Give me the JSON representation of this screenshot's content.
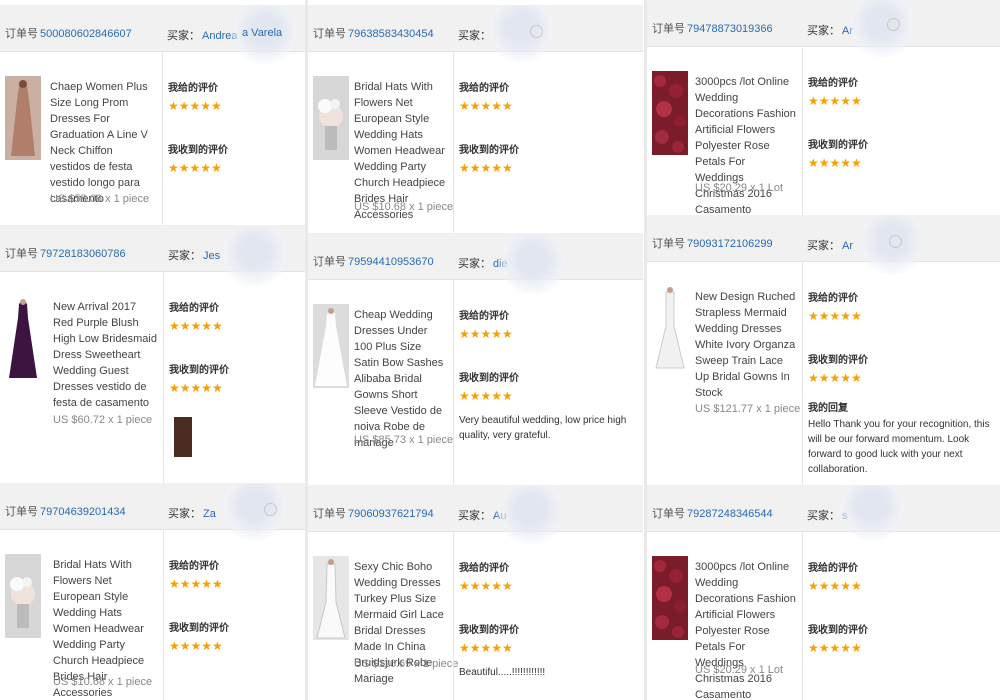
{
  "labels": {
    "order_prefix": "订单号",
    "buyer_prefix": "买家：",
    "my_review": "我给的评价",
    "received_review": "我收到的评价",
    "my_reply": "我的回复"
  },
  "colors": {
    "stars": "#f7a000",
    "link": "#2a6ab5",
    "header_bg": "#f1f1f1"
  },
  "orders": [
    {
      "order_no": "500080602846607",
      "buyer": "Andrea",
      "buyer_suffix": "a Varela",
      "title": "Chaep Women Plus Size Long Prom Dresses For Graduation A Line V Neck Chiffon vestidos de festa vestido longo para casamento",
      "price": "US $58.08 x 1 piece",
      "given_stars": "★★★★★",
      "received_stars": "★★★★★",
      "comment": "",
      "reply": "",
      "thumb_icon": "evening-dress-icon"
    },
    {
      "order_no": "79638583430454",
      "buyer": "",
      "buyer_suffix": "",
      "title": "Bridal Hats With Flowers Net European Style Wedding Hats Women Headwear Wedding Party Church Headpiece Brides Hair Accessories",
      "price": "US $10.68 x 1 piece",
      "given_stars": "★★★★★",
      "received_stars": "★★★★★",
      "comment": "",
      "reply": "",
      "thumb_icon": "bridal-hat-icon"
    },
    {
      "order_no": "79478873019366",
      "buyer": "Ar",
      "buyer_suffix": "",
      "title": "3000pcs /lot Online Wedding Decorations Fashion Artificial Flowers Polyester Rose Petals For Weddings Christmas 2016 Casamento",
      "price": "US $20.29 x 1 Lot",
      "given_stars": "★★★★★",
      "received_stars": "★★★★★",
      "comment": "",
      "reply": "",
      "thumb_icon": "rose-petals-icon"
    },
    {
      "order_no": "79728183060786",
      "buyer": "Jes",
      "buyer_suffix": "",
      "title": "New Arrival 2017 Red Purple Blush High Low Bridesmaid Dress Sweetheart Wedding Guest Dresses vestido de festa de casamento",
      "price": "US $60.72 x 1 piece",
      "given_stars": "★★★★★",
      "received_stars": "★★★★★",
      "comment": "",
      "reply": "",
      "thumb_icon": "bridesmaid-dress-icon"
    },
    {
      "order_no": "79594410953670",
      "buyer": "die",
      "buyer_suffix": "",
      "title": "Cheap Wedding Dresses Under 100 Plus Size Satin Bow Sashes Alibaba Bridal Gowns Short Sleeve Vestido de noiva Robe de mariage",
      "price": "US $85.73 x 1 piece",
      "given_stars": "★★★★★",
      "received_stars": "★★★★★",
      "comment": "Very beautiful wedding, low price high quality, very grateful.",
      "reply": "",
      "thumb_icon": "wedding-gown-icon"
    },
    {
      "order_no": "79093172106299",
      "buyer": "Ar",
      "buyer_suffix": "",
      "title": "New Design Ruched Strapless Mermaid Wedding Dresses White Ivory Organza Sweep Train Lace Up Bridal Gowns In Stock",
      "price": "US $121.77 x 1 piece",
      "given_stars": "★★★★★",
      "received_stars": "★★★★★",
      "comment": "",
      "reply": "Hello Thank you for your recognition, this will be our forward momentum. Look forward to good luck with your next collaboration.",
      "thumb_icon": "mermaid-gown-icon"
    },
    {
      "order_no": "79704639201434",
      "buyer": "Za",
      "buyer_suffix": "",
      "title": "Bridal Hats With Flowers Net European Style Wedding Hats Women Headwear Wedding Party Church Headpiece Brides Hair Accessories",
      "price": "US $10.68 x 1 piece",
      "given_stars": "★★★★★",
      "received_stars": "★★★★★",
      "comment": "",
      "reply": "",
      "thumb_icon": "bridal-hat-icon"
    },
    {
      "order_no": "79060937621794",
      "buyer": "Au",
      "buyer_suffix": "",
      "title": "Sexy Chic Boho Wedding Dresses Turkey Plus Size Mermaid Girl Lace Bridal Dresses Made In China Bruidsjurk Robe Mariage",
      "price": "US $116.69 x 1 piece",
      "given_stars": "★★★★★",
      "received_stars": "★★★★★",
      "comment": "Beautiful.....!!!!!!!!!!!!",
      "reply": "",
      "thumb_icon": "lace-gown-icon"
    },
    {
      "order_no": "79287248346544",
      "buyer": "s",
      "buyer_suffix": "",
      "title": "3000pcs /lot Online Wedding Decorations Fashion Artificial Flowers Polyester Rose Petals For Weddings Christmas 2016 Casamento",
      "price": "US $20.29 x 1 Lot",
      "given_stars": "★★★★★",
      "received_stars": "★★★★★",
      "comment": "",
      "reply": "",
      "thumb_icon": "rose-petals-icon"
    }
  ]
}
